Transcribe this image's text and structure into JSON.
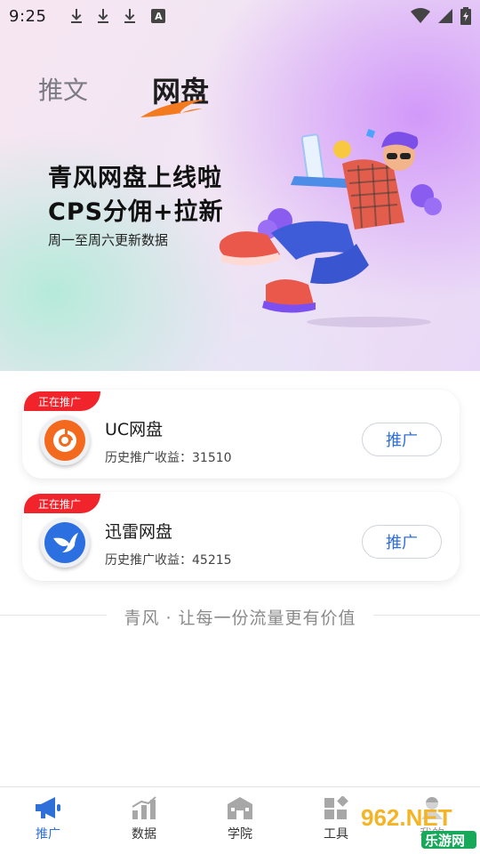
{
  "status_bar": {
    "time": "9:25",
    "icons": [
      "download-icon",
      "download-icon",
      "download-icon",
      "a-icon",
      "wifi-icon",
      "signal-icon",
      "battery-icon"
    ],
    "a_glyph": "A"
  },
  "top_tabs": {
    "tab1": "推文",
    "tab2": "网盘",
    "active": "网盘"
  },
  "banner": {
    "title_line1": "青风网盘上线啦",
    "title_line2": "CPS分佣+拉新",
    "subtitle": "周一至周六更新数据"
  },
  "cards": [
    {
      "badge": "正在推广",
      "name": "UC网盘",
      "income_label": "历史推广收益:",
      "income_value": "31510",
      "income_text": "历史推广收益：31510",
      "button": "推广",
      "logo": "uc-logo-icon"
    },
    {
      "badge": "正在推广",
      "name": "迅雷网盘",
      "income_label": "历史推广收益:",
      "income_value": "45215",
      "income_text": "历史推广收益：45215",
      "button": "推广",
      "logo": "thunder-logo-icon"
    }
  ],
  "slogan": "青风 · 让每一份流量更有价值",
  "bottom_nav": [
    {
      "label": "推广",
      "icon": "megaphone-icon",
      "active": true
    },
    {
      "label": "数据",
      "icon": "chart-icon",
      "active": false
    },
    {
      "label": "学院",
      "icon": "school-icon",
      "active": false
    },
    {
      "label": "工具",
      "icon": "tools-icon",
      "active": false
    },
    {
      "label": "我的",
      "icon": "user-icon",
      "active": false
    }
  ],
  "watermark": {
    "line1": "962.NET",
    "line2": "乐游网"
  },
  "colors": {
    "accent_blue": "#2f6fd8",
    "badge_red": "#f1232b",
    "tab_underline_orange": "#f47a1f",
    "uc_orange": "#f36a1f",
    "thunder_blue": "#2b6fe0"
  }
}
